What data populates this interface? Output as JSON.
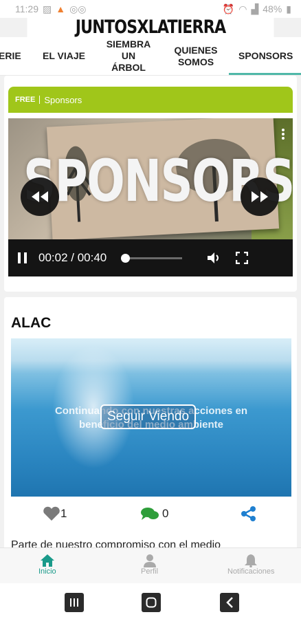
{
  "status_bar": {
    "time": "11:29",
    "battery": "48%"
  },
  "app": {
    "brand": "JUNTOSXLATIERRA"
  },
  "tabs": [
    {
      "label": "ERIE"
    },
    {
      "label": "EL VIAJE"
    },
    {
      "label": "SIEMBRA UN ÁRBOL",
      "line1": "SIEMBRA",
      "line2": "UN ÁRBOL"
    },
    {
      "label": "QUIENES SOMOS",
      "line1": "QUIENES",
      "line2": "SOMOS"
    },
    {
      "label": "SPONSORS",
      "active": true
    }
  ],
  "video_card": {
    "free_tag": "FREE",
    "category": "Sponsors",
    "video_title": "SPONSORS",
    "current_time": "00:02",
    "duration": "00:40",
    "time_display": "00:02 / 00:40",
    "progress_fraction": 0.05
  },
  "post": {
    "title": "ALAC",
    "image_caption": "Continuando con nuestras acciones en beneficio del medio ambiente",
    "button_label": "Seguir Viendo",
    "likes": "1",
    "comments": "0",
    "text": "Parte de nuestro compromiso con el medio"
  },
  "bottom_nav": [
    {
      "label": "Inicio",
      "icon": "home-icon",
      "active": true
    },
    {
      "label": "Perfil",
      "icon": "person-icon"
    },
    {
      "label": "Notificaciones",
      "icon": "bell-icon"
    }
  ],
  "colors": {
    "accent": "#1a9a8a",
    "tab_underline": "#4fb8a8",
    "free_bar": "#a0c61a",
    "like_icon": "#7a7a7a",
    "comment_icon": "#2e9e3a",
    "share_icon": "#1e7fd0"
  }
}
